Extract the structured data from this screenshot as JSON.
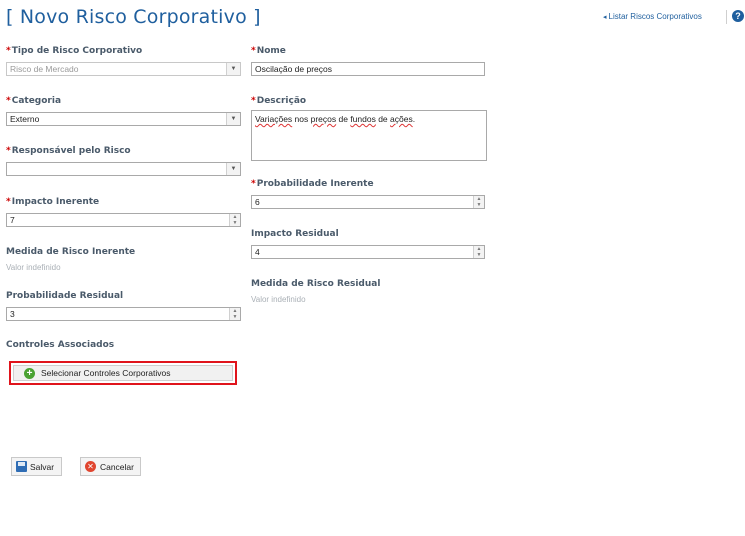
{
  "page": {
    "title": "[ Novo Risco Corporativo ]",
    "list_link": "Listar Riscos Corporativos",
    "help_glyph": "?"
  },
  "form": {
    "tipo": {
      "label": "Tipo de Risco Corporativo",
      "value": "Risco de Mercado"
    },
    "nome": {
      "label": "Nome",
      "value": "Oscilação de preços"
    },
    "categoria": {
      "label": "Categoria",
      "value": "Externo"
    },
    "descricao": {
      "label": "Descrição",
      "value_parts": [
        "Variações",
        " nos ",
        "preços",
        " de ",
        "fundos",
        " de ",
        "ações",
        "."
      ]
    },
    "responsavel": {
      "label": "Responsável pelo Risco",
      "value": ""
    },
    "probabilidade_inerente": {
      "label": "Probabilidade Inerente",
      "value": "6"
    },
    "impacto_inerente": {
      "label": "Impacto Inerente",
      "value": "7"
    },
    "impacto_residual": {
      "label": "Impacto Residual",
      "value": "4"
    },
    "medida_inerente": {
      "label": "Medida de Risco Inerente",
      "value": "Valor indefinido"
    },
    "medida_residual": {
      "label": "Medida de Risco Residual",
      "value": "Valor indefinido"
    },
    "probabilidade_residual": {
      "label": "Probabilidade Residual",
      "value": "3"
    },
    "controles": {
      "label": "Controles Associados",
      "button": "Selecionar Controles Corporativos"
    },
    "required_mark": "*"
  },
  "actions": {
    "save": "Salvar",
    "cancel": "Cancelar"
  },
  "icons": {
    "add": "plus-circle-icon",
    "save": "floppy-disk-icon",
    "cancel": "cancel-circle-icon",
    "help": "help-icon"
  },
  "colors": {
    "title": "#1f5f9e",
    "required": "#cc0000",
    "highlight_border": "#e0141c"
  }
}
